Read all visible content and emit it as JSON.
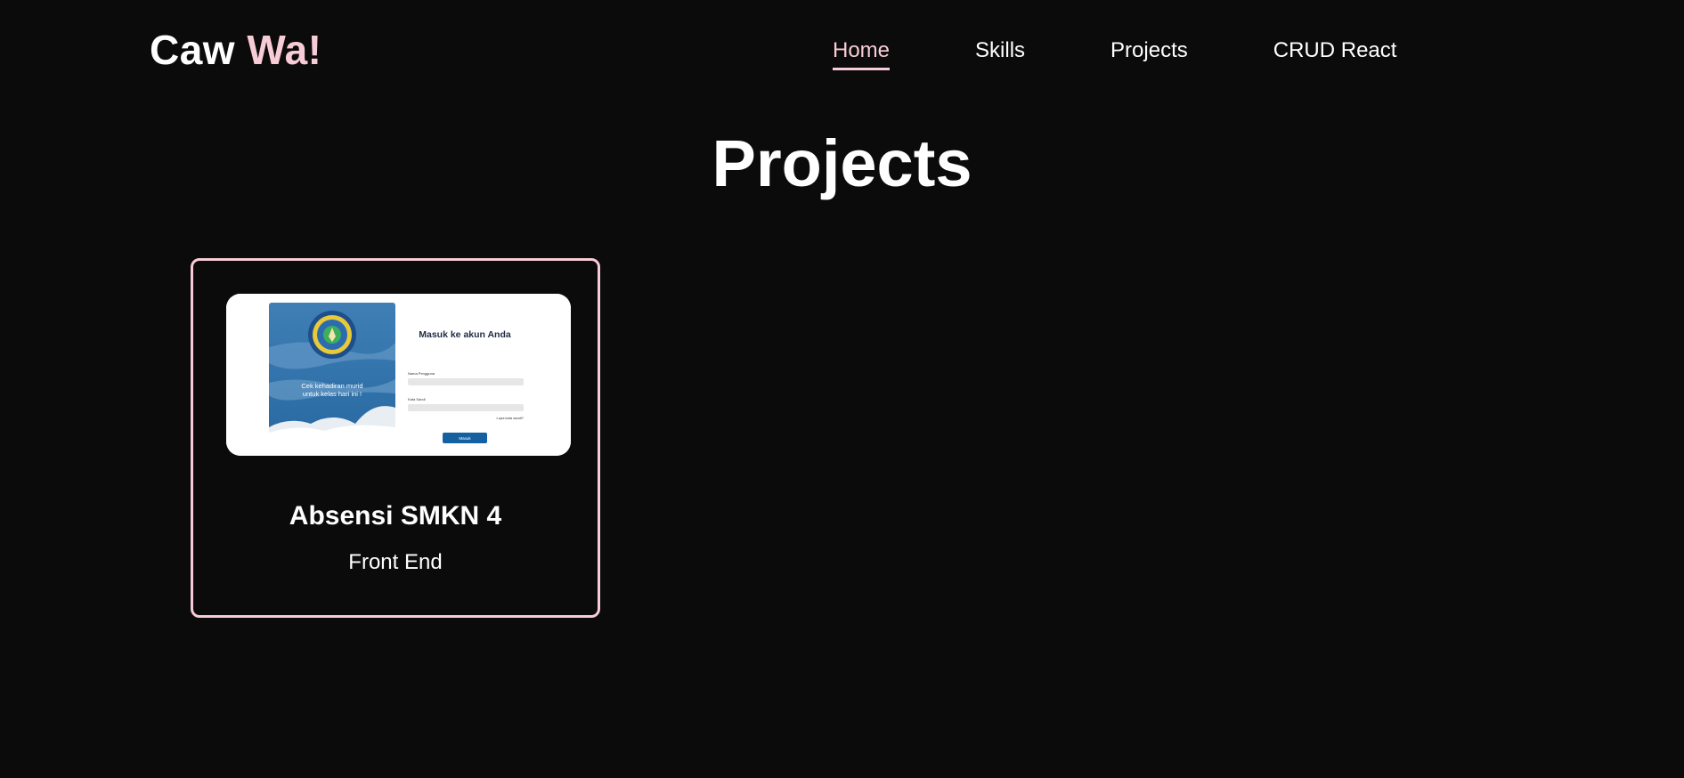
{
  "header": {
    "logo_main": "Caw ",
    "logo_accent": "Wa!"
  },
  "nav": {
    "items": [
      {
        "label": "Home",
        "active": true
      },
      {
        "label": "Skills",
        "active": false
      },
      {
        "label": "Projects",
        "active": false
      },
      {
        "label": "CRUD React",
        "active": false
      }
    ]
  },
  "main": {
    "section_title": "Projects",
    "projects": [
      {
        "title": "Absensi SMKN 4",
        "category": "Front End",
        "thumbnail": {
          "login_heading": "Masuk ke akun Anda",
          "left_text_line1": "Cek kehadiran murid",
          "left_text_line2": "untuk kelas hari ini !",
          "username_label": "Nama Pengguna",
          "password_label": "Kata Sandi",
          "forgot_link": "Lupa kata sandi?",
          "login_button": "Masuk"
        }
      }
    ]
  },
  "colors": {
    "background": "#0b0b0b",
    "accent": "#f8ccd6",
    "text": "#ffffff",
    "thumb_blue": "#2f6ea6",
    "thumb_button": "#1560a0"
  }
}
